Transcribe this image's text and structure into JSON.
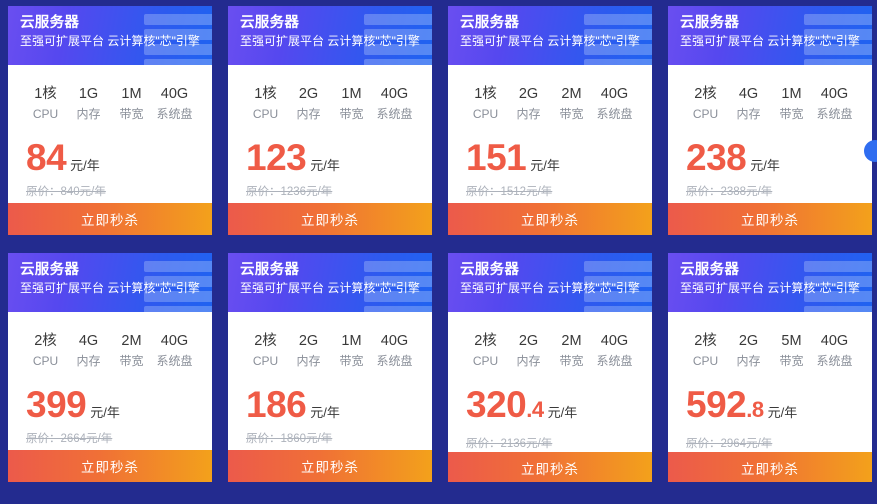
{
  "page": {
    "background_color": "#232b8f",
    "accent_price_color": "#ef5b46",
    "header_gradient_from": "#6a4ef0",
    "header_gradient_to": "#1f63f0",
    "button_gradient_from": "#ec5a4b",
    "button_gradient_to": "#f3a11b"
  },
  "labels": {
    "cpu": "CPU",
    "memory": "内存",
    "bandwidth": "带宽",
    "disk": "系统盘",
    "unit": "元/年",
    "orig_prefix": "原价：",
    "orig_suffix": "元/年",
    "buy": "立即秒杀"
  },
  "cards": [
    {
      "title": "云服务器",
      "subtitle": "至强可扩展平台 云计算核\"芯\"引擎",
      "cpu": "1核",
      "memory": "1G",
      "bandwidth": "1M",
      "disk": "40G",
      "price_int": "84",
      "price_dec": "",
      "unit": "元/年",
      "orig": "原价：840元/年",
      "buy": "立即秒杀"
    },
    {
      "title": "云服务器",
      "subtitle": "至强可扩展平台 云计算核\"芯\"引擎",
      "cpu": "1核",
      "memory": "2G",
      "bandwidth": "1M",
      "disk": "40G",
      "price_int": "123",
      "price_dec": "",
      "unit": "元/年",
      "orig": "原价：1236元/年",
      "buy": "立即秒杀"
    },
    {
      "title": "云服务器",
      "subtitle": "至强可扩展平台 云计算核\"芯\"引擎",
      "cpu": "1核",
      "memory": "2G",
      "bandwidth": "2M",
      "disk": "40G",
      "price_int": "151",
      "price_dec": "",
      "unit": "元/年",
      "orig": "原价：1512元/年",
      "buy": "立即秒杀"
    },
    {
      "title": "云服务器",
      "subtitle": "至强可扩展平台 云计算核\"芯\"引擎",
      "cpu": "2核",
      "memory": "4G",
      "bandwidth": "1M",
      "disk": "40G",
      "price_int": "238",
      "price_dec": "",
      "unit": "元/年",
      "orig": "原价：2388元/年",
      "buy": "立即秒杀"
    },
    {
      "title": "云服务器",
      "subtitle": "至强可扩展平台 云计算核\"芯\"引擎",
      "cpu": "2核",
      "memory": "4G",
      "bandwidth": "2M",
      "disk": "40G",
      "price_int": "399",
      "price_dec": "",
      "unit": "元/年",
      "orig": "原价：2664元/年",
      "buy": "立即秒杀"
    },
    {
      "title": "云服务器",
      "subtitle": "至强可扩展平台 云计算核\"芯\"引擎",
      "cpu": "2核",
      "memory": "2G",
      "bandwidth": "1M",
      "disk": "40G",
      "price_int": "186",
      "price_dec": "",
      "unit": "元/年",
      "orig": "原价：1860元/年",
      "buy": "立即秒杀"
    },
    {
      "title": "云服务器",
      "subtitle": "至强可扩展平台 云计算核\"芯\"引擎",
      "cpu": "2核",
      "memory": "2G",
      "bandwidth": "2M",
      "disk": "40G",
      "price_int": "320",
      "price_dec": ".4",
      "unit": "元/年",
      "orig": "原价：2136元/年",
      "buy": "立即秒杀"
    },
    {
      "title": "云服务器",
      "subtitle": "至强可扩展平台 云计算核\"芯\"引擎",
      "cpu": "2核",
      "memory": "2G",
      "bandwidth": "5M",
      "disk": "40G",
      "price_int": "592",
      "price_dec": ".8",
      "unit": "元/年",
      "orig": "原价：2964元/年",
      "buy": "立即秒杀"
    }
  ]
}
